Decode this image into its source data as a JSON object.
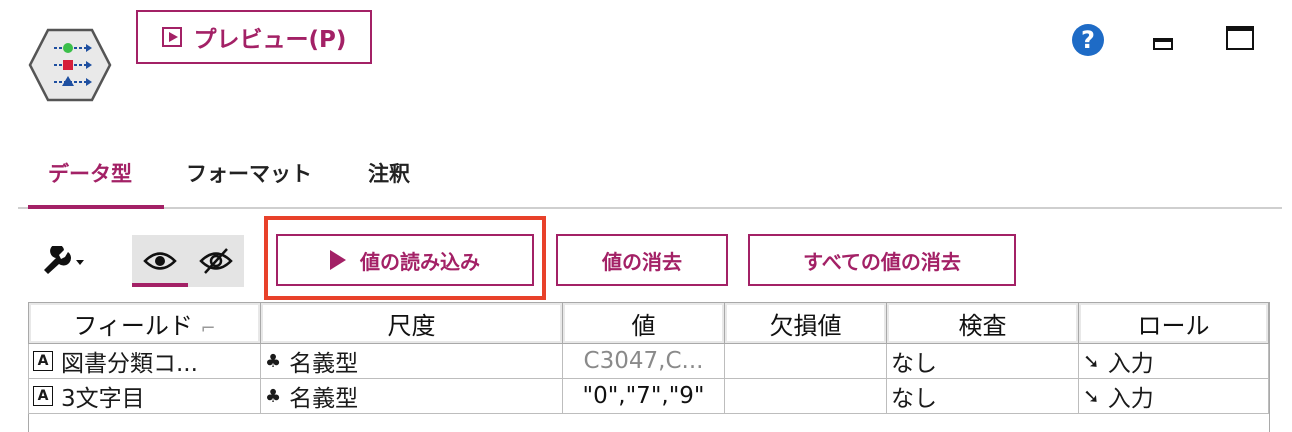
{
  "node_icon": "field-type-node-icon",
  "preview_button": {
    "label": "プレビュー(P)",
    "icon": "play-box-icon"
  },
  "window_icons": {
    "help": "?",
    "minimize": "minimize-icon",
    "maximize": "maximize-icon"
  },
  "tabs": [
    {
      "label": "データ型",
      "active": true
    },
    {
      "label": "フォーマット",
      "active": false
    },
    {
      "label": "注釈",
      "active": false
    }
  ],
  "toolbar": {
    "wrench_icon": "wrench-dropdown-icon",
    "eye_icon": "eye-icon",
    "eye_hidden_icon": "eye-slash-icon",
    "read_values_label": "値の読み込み",
    "clear_values_label": "値の消去",
    "clear_all_values_label": "すべての値の消去"
  },
  "colors": {
    "accent": "#a32166",
    "highlight": "#e8412a",
    "help": "#1e6bc6"
  },
  "table": {
    "columns": [
      "フィールド",
      "尺度",
      "値",
      "欠損値",
      "検査",
      "ロール"
    ],
    "rows": [
      {
        "type_icon": "A",
        "field": "図書分類コ...",
        "measure_icon": "nominal-icon",
        "measure": "名義型",
        "values": "C3047,C...",
        "missing": "",
        "check": "なし",
        "role_icon": "input-arrow-icon",
        "role": "入力"
      },
      {
        "type_icon": "A",
        "field": "3文字目",
        "measure_icon": "nominal-icon",
        "measure": "名義型",
        "values": "\"0\",\"7\",\"9\"",
        "missing": "",
        "check": "なし",
        "role_icon": "input-arrow-icon",
        "role": "入力"
      }
    ]
  }
}
